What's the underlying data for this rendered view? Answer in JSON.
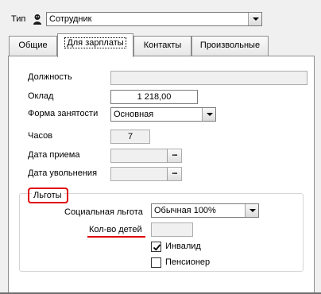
{
  "type_row": {
    "label": "Тип",
    "icon": "person-icon",
    "value": "Сотрудник"
  },
  "tabs": [
    {
      "label": "Общие",
      "active": false
    },
    {
      "label": "Для зарплаты",
      "active": true
    },
    {
      "label": "Контакты",
      "active": false
    },
    {
      "label": "Произвольные",
      "active": false
    }
  ],
  "salary_tab": {
    "position_label": "Должность",
    "position_value": "",
    "salary_label": "Оклад",
    "salary_value": "1 218,00",
    "employment_label": "Форма занятости",
    "employment_value": "Основная",
    "hours_label": "Часов",
    "hours_value": "7",
    "hire_date_label": "Дата приема",
    "hire_date_value": "",
    "dismissal_date_label": "Дата увольнения",
    "dismissal_date_value": "",
    "dots_label": "..."
  },
  "benefits": {
    "group_label": "Льготы",
    "social_label": "Социальная льгота",
    "social_value": "Обычная 100%",
    "children_label": "Кол-во детей",
    "children_value": "",
    "invalid_label": "Инвалид",
    "invalid_checked": true,
    "pensioner_label": "Пенсионер",
    "pensioner_checked": false
  },
  "colors": {
    "highlight": "#e00000"
  }
}
